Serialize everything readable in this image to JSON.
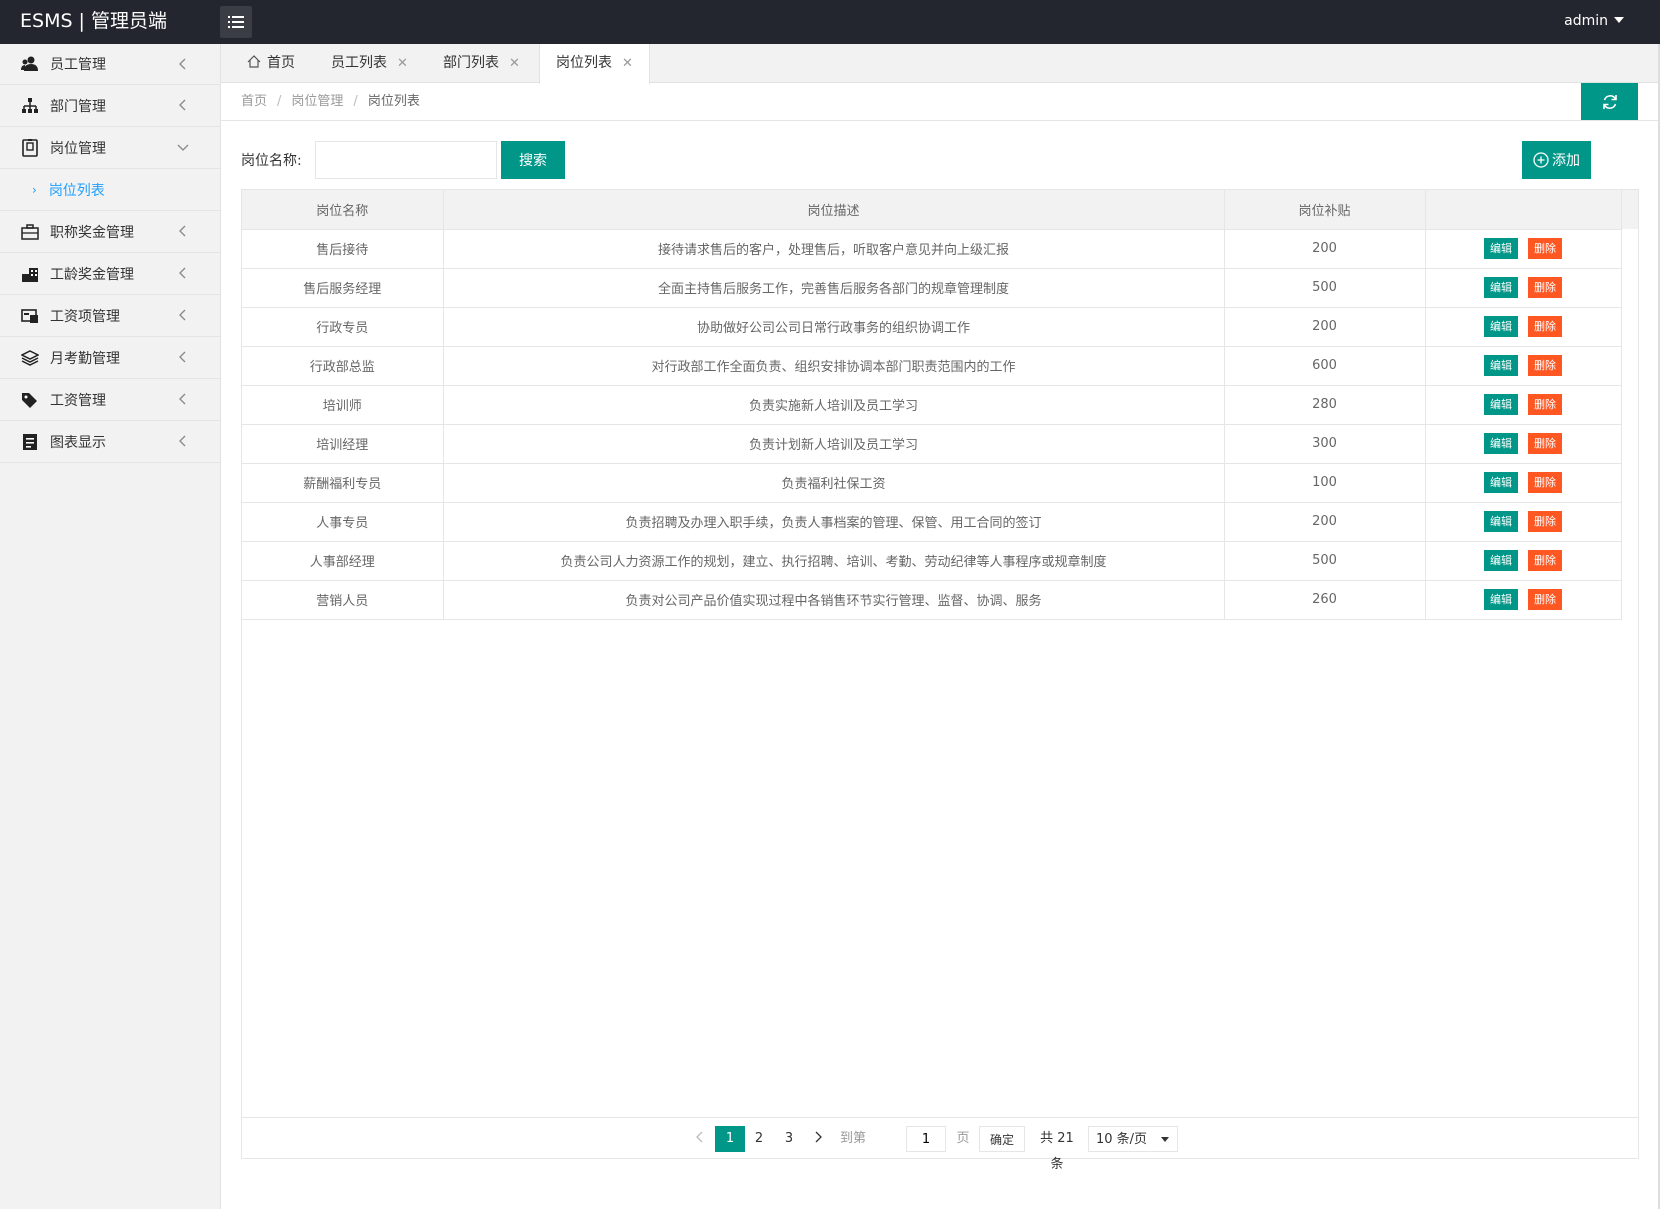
{
  "header": {
    "logo": "ESMS | 管理员端",
    "user": "admin"
  },
  "sidebar": {
    "items": [
      {
        "label": "员工管理",
        "icon": "users-icon"
      },
      {
        "label": "部门管理",
        "icon": "sitemap-icon"
      },
      {
        "label": "岗位管理",
        "icon": "id-badge-icon",
        "expanded": true,
        "sub": "岗位列表"
      },
      {
        "label": "职称奖金管理",
        "icon": "briefcase-icon"
      },
      {
        "label": "工龄奖金管理",
        "icon": "building-icon"
      },
      {
        "label": "工资项管理",
        "icon": "card-icon"
      },
      {
        "label": "月考勤管理",
        "icon": "layers-icon"
      },
      {
        "label": "工资管理",
        "icon": "tags-icon"
      },
      {
        "label": "图表显示",
        "icon": "receipt-icon"
      }
    ]
  },
  "tabs": [
    {
      "label": "首页",
      "icon": "home-icon"
    },
    {
      "label": "员工列表"
    },
    {
      "label": "部门列表"
    },
    {
      "label": "岗位列表",
      "active": true
    }
  ],
  "breadcrumb": {
    "home": "首页",
    "parent": "岗位管理",
    "current": "岗位列表",
    "sep": "/"
  },
  "search": {
    "label": "岗位名称:",
    "value": "",
    "placeholder": "",
    "button": "搜索"
  },
  "add_button": "添加",
  "table": {
    "headers": [
      "岗位名称",
      "岗位描述",
      "岗位补贴",
      ""
    ],
    "edit_label": "编辑",
    "delete_label": "删除",
    "rows": [
      {
        "name": "售后接待",
        "desc": "接待请求售后的客户，处理售后，听取客户意见并向上级汇报",
        "subsidy": "200"
      },
      {
        "name": "售后服务经理",
        "desc": "全面主持售后服务工作，完善售后服务各部门的规章管理制度",
        "subsidy": "500"
      },
      {
        "name": "行政专员",
        "desc": "协助做好公司公司日常行政事务的组织协调工作",
        "subsidy": "200"
      },
      {
        "name": "行政部总监",
        "desc": "对行政部工作全面负责、组织安排协调本部门职责范围内的工作",
        "subsidy": "600"
      },
      {
        "name": "培训师",
        "desc": "负责实施新人培训及员工学习",
        "subsidy": "280"
      },
      {
        "name": "培训经理",
        "desc": "负责计划新人培训及员工学习",
        "subsidy": "300"
      },
      {
        "name": "薪酬福利专员",
        "desc": "负责福利社保工资",
        "subsidy": "100"
      },
      {
        "name": "人事专员",
        "desc": "负责招聘及办理入职手续，负责人事档案的管理、保管、用工合同的签订",
        "subsidy": "200"
      },
      {
        "name": "人事部经理",
        "desc": "负责公司人力资源工作的规划，建立、执行招聘、培训、考勤、劳动纪律等人事程序或规章制度",
        "subsidy": "500"
      },
      {
        "name": "营销人员",
        "desc": "负责对公司产品价值实现过程中各销售环节实行管理、监督、协调、服务",
        "subsidy": "260"
      }
    ]
  },
  "pagination": {
    "pages": [
      "1",
      "2",
      "3"
    ],
    "current": "1",
    "goto_label": "到第",
    "goto_value": "1",
    "page_unit": "页",
    "confirm": "确定",
    "total": "共 21 条",
    "page_size": "10 条/页"
  },
  "colors": {
    "primary": "#009688",
    "danger": "#ff5722",
    "header_bg": "#23262e",
    "link": "#1e9fff"
  }
}
